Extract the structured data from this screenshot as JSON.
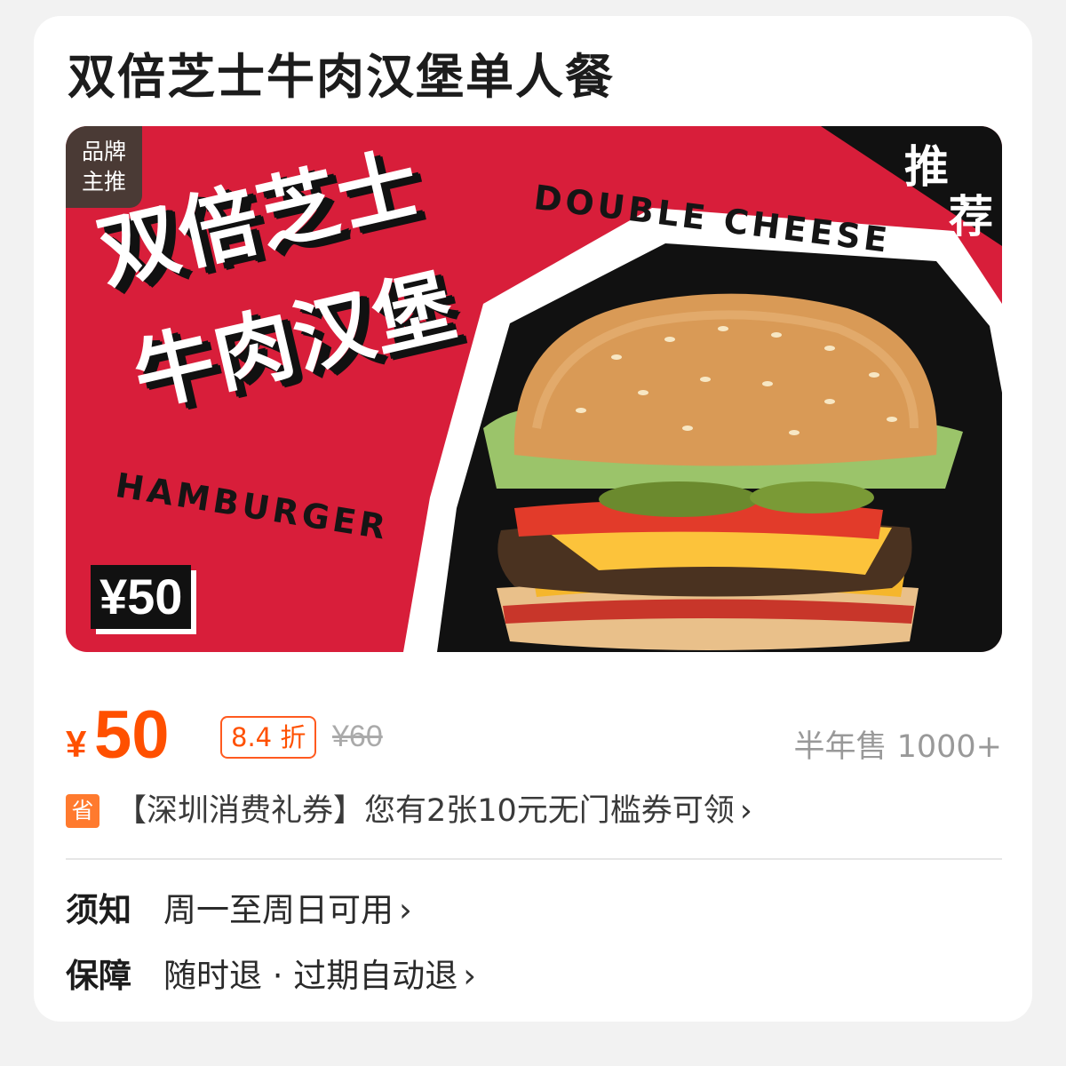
{
  "product": {
    "title": "双倍芝士牛肉汉堡单人餐"
  },
  "banner": {
    "brand_tag_line1": "品牌",
    "brand_tag_line2": "主推",
    "headline_line1": "双倍芝士",
    "headline_line2": "牛肉汉堡",
    "double_cheese": "DOUBLE CHEESE",
    "hamburger": "HAMBURGER",
    "recommend_1": "推",
    "recommend_2": "荐",
    "price": "¥50",
    "colors": {
      "background": "#d81e3a",
      "frame": "#111111"
    }
  },
  "price": {
    "symbol": "¥",
    "value": "50",
    "discount": "8.4 折",
    "original": "¥60",
    "sales": "半年售 1000+"
  },
  "coupon": {
    "icon_text": "省",
    "text": "【深圳消费礼券】您有2张10元无门槛券可领",
    "chevron": "›"
  },
  "info": [
    {
      "label": "须知",
      "value": "周一至周日可用",
      "chevron": "›"
    },
    {
      "label": "保障",
      "value": "随时退 · 过期自动退",
      "chevron": "›"
    }
  ],
  "accent_color": "#ff5000"
}
